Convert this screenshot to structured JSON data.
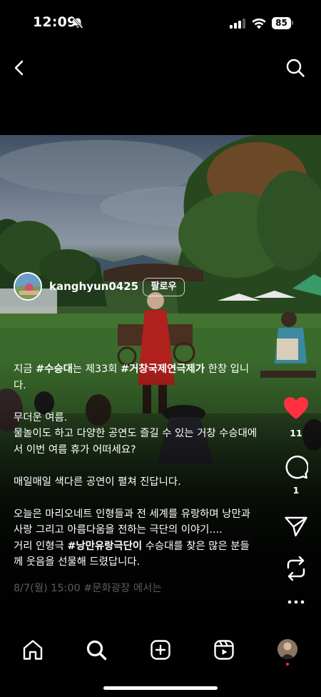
{
  "status_bar": {
    "time": "12:09",
    "battery": "85"
  },
  "post": {
    "username": "kanghyun0425",
    "follow_label": "팔로우",
    "likes": "11",
    "comments": "1"
  },
  "caption": {
    "line1_prefix": "지금 ",
    "line1_tag1": "#수승대",
    "line1_mid": "는 제33회 ",
    "line1_tag2": "#거창국제연극제가",
    "line1_suffix": " 한창 입니",
    "line2": "다.",
    "line3": "무더운 여름.",
    "line4": "물놀이도 하고 다양한 공연도 즐길 수 있는 거창 수승대에",
    "line5": "서 이번 여름 휴가 어떠세요?",
    "line6": "매일매일 색다른 공연이 펼쳐 진답니다.",
    "line7": "오늘은 마리오네트 인형들과 전 세계를 유랑하며 낭만과",
    "line8": "사랑 그리고 아름다움을 전하는 극단의 이야기....",
    "line9_prefix": "거리 인형극 ",
    "line9_tag": "#낭만유랑극단이",
    "line9_suffix": " 수승대를 찾은 많은 분들",
    "line10": "께 웃음을 선물해 드렸답니다.",
    "line11": "8/7(월) 15:00 #문화광장 에서는"
  },
  "icons": {
    "back": "chevron-left-icon",
    "search": "search-icon",
    "like": "heart-filled-icon",
    "comment": "comment-bubble-icon",
    "share": "paper-plane-icon",
    "repost": "repost-icon",
    "more": "more-horizontal-icon",
    "nav": [
      "home-icon",
      "search-icon",
      "create-plus-icon",
      "reels-icon",
      "profile-avatar"
    ]
  },
  "colors": {
    "like": "#ff3040",
    "background": "#000000",
    "text": "#ffffff"
  }
}
